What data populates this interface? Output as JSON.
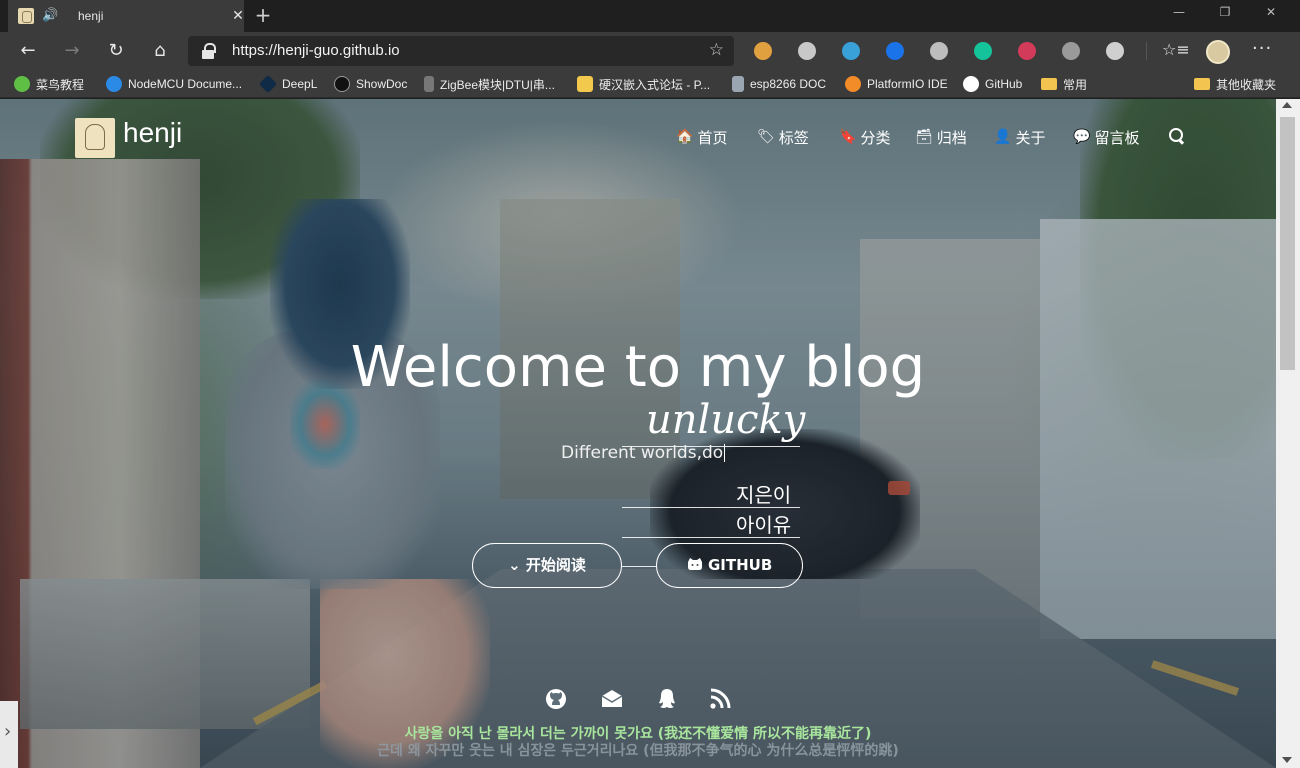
{
  "browser": {
    "tab": {
      "title": "henji",
      "audio_icon": "speaker-icon",
      "close": "✕"
    },
    "new_tab": "+",
    "window_controls": {
      "minimize": "—",
      "maximize": "❐",
      "close": "✕"
    },
    "nav": {
      "back": "←",
      "forward": "→",
      "reload": "↻",
      "home": "⌂"
    },
    "url": "https://henji-guo.github.io",
    "favorite_star": "☆",
    "favorites_list_icon": "☆≡",
    "more": "···",
    "extensions": [
      {
        "name": "owl-extension-icon",
        "color": "#e0a040"
      },
      {
        "name": "shield-extension-icon",
        "color": "#c8c8c8"
      },
      {
        "name": "globe-extension-icon",
        "color": "#3aa0d8"
      },
      {
        "name": "n-extension-icon",
        "color": "#1a73e8"
      },
      {
        "name": "v-extension-icon",
        "color": "#bdbdbd"
      },
      {
        "name": "grammarly-extension-icon",
        "color": "#15c39a"
      },
      {
        "name": "download-extension-icon",
        "color": "#d33b5a"
      },
      {
        "name": "ghost-extension-icon",
        "color": "#9a9a9a"
      },
      {
        "name": "reader-extension-icon",
        "color": "#cfcfcf"
      }
    ],
    "bookmarks": [
      {
        "label": "菜鸟教程",
        "icon_color": "#5fbf45"
      },
      {
        "label": "NodeMCU Docume...",
        "icon_color": "#2b8ae6"
      },
      {
        "label": "DeepL",
        "icon_color": "#0f2b46"
      },
      {
        "label": "ShowDoc",
        "icon_color": "#111111"
      },
      {
        "label": "ZigBee模块|DTU|串...",
        "icon_color": "#777777"
      },
      {
        "label": "硬汉嵌入式论坛 - P...",
        "icon_color": "#f2c94c"
      },
      {
        "label": "esp8266 DOC",
        "icon_color": "#9aa6b2"
      },
      {
        "label": "PlatformIO IDE",
        "icon_color": "#f28c28"
      },
      {
        "label": "GitHub",
        "icon_color": "#ffffff"
      },
      {
        "label": "常用",
        "icon_color": "#f3c44f"
      }
    ],
    "other_bookmarks": "其他收藏夹"
  },
  "site": {
    "name": "henji",
    "menu": [
      {
        "icon": "🏠",
        "label": "首页",
        "icon_name": "home-icon"
      },
      {
        "icon": "🏷",
        "label": "标签",
        "icon_name": "tag-icon"
      },
      {
        "icon": "🔖",
        "label": "分类",
        "icon_name": "bookmark-icon"
      },
      {
        "icon": "🗃",
        "label": "归档",
        "icon_name": "archive-icon"
      },
      {
        "icon": "👤",
        "label": "关于",
        "icon_name": "user-icon"
      },
      {
        "icon": "💬",
        "label": "留言板",
        "icon_name": "comments-icon"
      }
    ]
  },
  "hero": {
    "title": "Welcome to my blog",
    "signature": "unlucky",
    "subtitle": "Different worlds,do",
    "korean_name_1": "지은이",
    "korean_name_2": "아이유",
    "read_button": "开始阅读",
    "read_button_icon": "⌄",
    "github_button": "GITHUB",
    "lyric_line_1": "사랑을 아직 난 몰라서 더는 가까이 못가요 (我还不懂爱情 所以不能再靠近了)",
    "lyric_line_2": "근데 왜 자꾸만 웃는 내 심장은 두근거리나요 (但我那不争气的心 为什么总是怦怦的跳)"
  }
}
